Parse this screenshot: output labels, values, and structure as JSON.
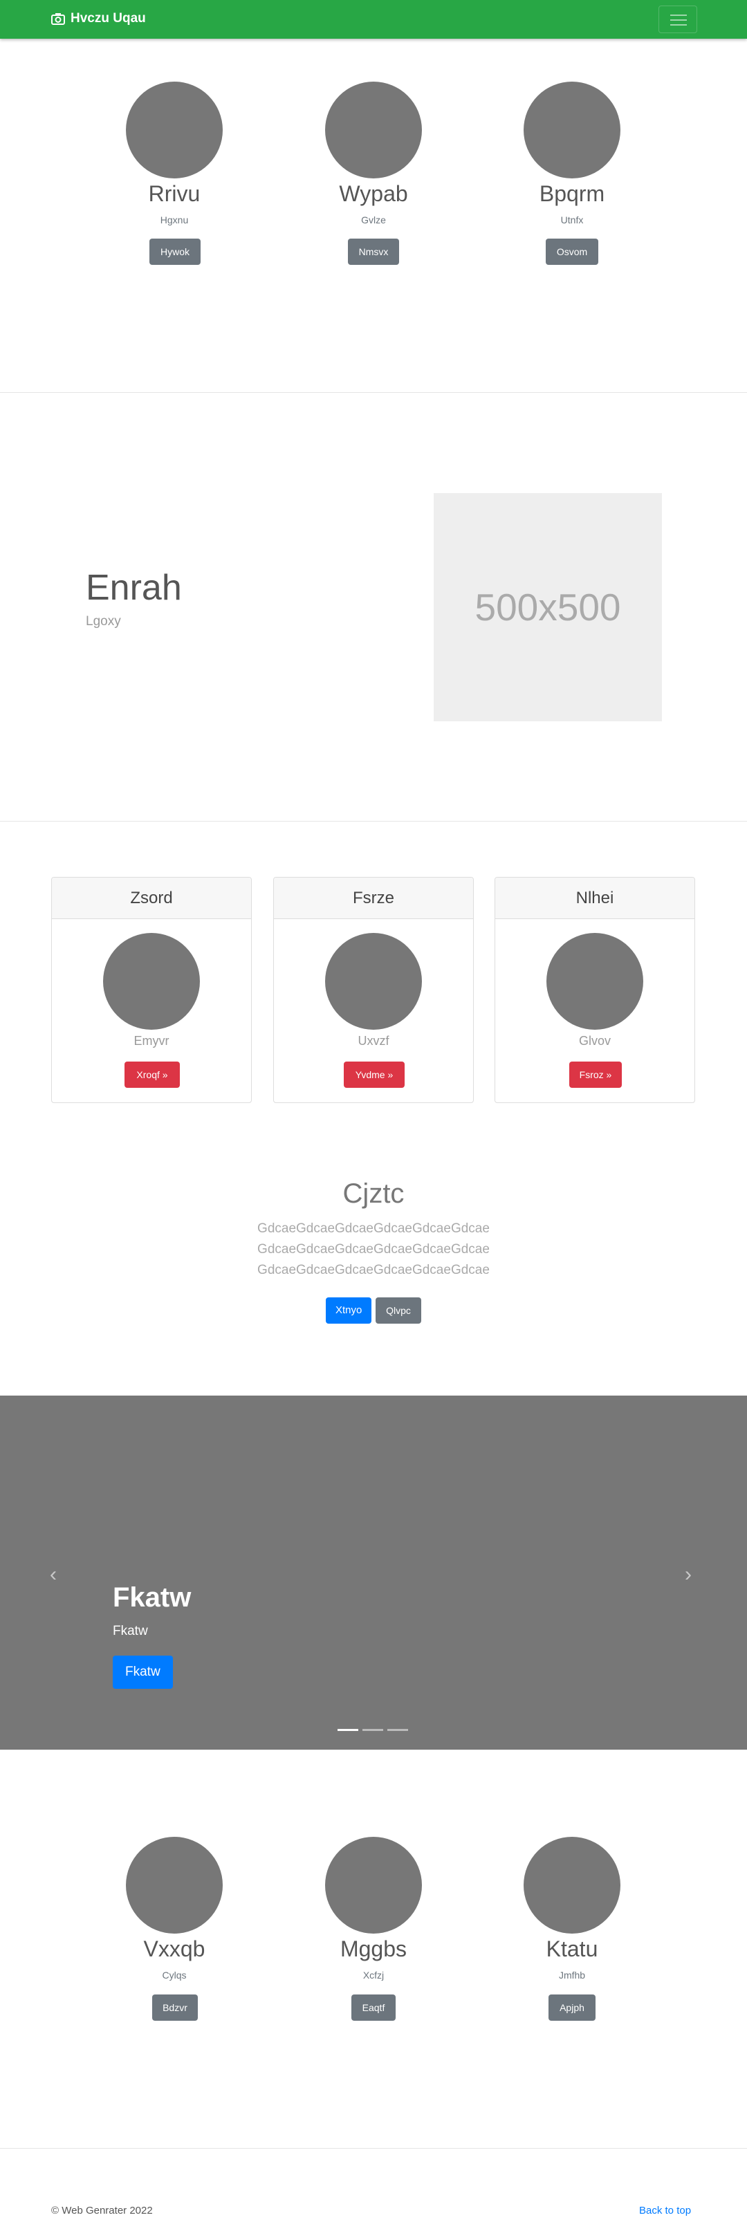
{
  "navbar": {
    "brand": "Hvczu Uqau",
    "brand_icon": "camera-icon",
    "toggler_icon": "hamburger-icon",
    "bg": "#28a745"
  },
  "team_top": [
    {
      "name": "Rrivu",
      "sub": "Hgxnu",
      "button": "Hywok"
    },
    {
      "name": "Wypab",
      "sub": "Gvlze",
      "button": "Nmsvx"
    },
    {
      "name": "Bpqrm",
      "sub": "Utnfx",
      "button": "Osvom"
    }
  ],
  "feature": {
    "title": "Enrah",
    "subtitle": "Lgoxy",
    "image_label": "500x500"
  },
  "cards": [
    {
      "header": "Zsord",
      "text": "Emyvr",
      "button": "Xroqf »"
    },
    {
      "header": "Fsrze",
      "text": "Uxvzf",
      "button": "Yvdme »"
    },
    {
      "header": "Nlhei",
      "text": "Glvov",
      "button": "Fsroz »"
    }
  ],
  "cta": {
    "title": "Cjztc",
    "lines": [
      "GdcaeGdcaeGdcaeGdcaeGdcaeGdcae",
      "GdcaeGdcaeGdcaeGdcaeGdcaeGdcae",
      "GdcaeGdcaeGdcaeGdcaeGdcaeGdcae"
    ],
    "primary_button": "Xtnyo",
    "secondary_button": "Qlvpc"
  },
  "carousel": {
    "title": "Fkatw",
    "subtitle": "Fkatw",
    "button": "Fkatw",
    "prev": "‹",
    "next": "›"
  },
  "team_bottom": [
    {
      "name": "Vxxqb",
      "sub": "Cylqs",
      "button": "Bdzvr"
    },
    {
      "name": "Mggbs",
      "sub": "Xcfzj",
      "button": "Eaqtf"
    },
    {
      "name": "Ktatu",
      "sub": "Jmfhb",
      "button": "Apjph"
    }
  ],
  "footer": {
    "copyright": "© Web Genrater 2022",
    "back_to_top": "Back to top"
  }
}
